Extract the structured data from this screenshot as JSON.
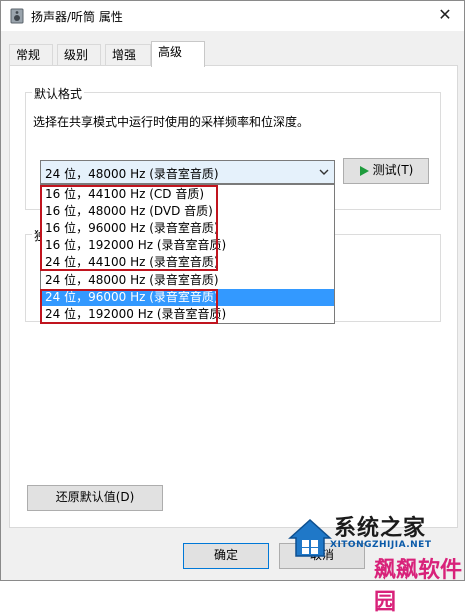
{
  "window": {
    "title": "扬声器/听筒 属性",
    "close_glyph": "✕"
  },
  "tabs": [
    {
      "label": "常规"
    },
    {
      "label": "级别"
    },
    {
      "label": "增强"
    },
    {
      "label": "高级",
      "active": true
    }
  ],
  "default_format": {
    "group_label": "默认格式",
    "description": "选择在共享模式中运行时使用的采样频率和位深度。",
    "selected": "24 位，48000 Hz (录音室音质)",
    "test_button": "测试(T)",
    "options": [
      "16 位，44100 Hz (CD 音质)",
      "16 位，48000 Hz (DVD 音质)",
      "16 位，96000 Hz (录音室音质)",
      "16 位，192000 Hz (录音室音质)",
      "24 位，44100 Hz (录音室音质)",
      "24 位，48000 Hz (录音室音质)",
      "24 位，96000 Hz (录音室音质)",
      "24 位，192000 Hz (录音室音质)"
    ],
    "highlighted_option_index": 6
  },
  "exclusive_group": {
    "label_partial": "独"
  },
  "buttons": {
    "restore_defaults": "还原默认值(D)",
    "ok": "确定",
    "cancel": "取消"
  },
  "watermark": {
    "top_text": "系统之家",
    "url": "XITONGZHIJIA.NET",
    "bottom_text": "飙飙软件园"
  },
  "colors": {
    "selection": "#3399ff",
    "annotation_red": "#c0141e",
    "combo_focus": "#e5f1fb",
    "play_green": "#1e9b3c"
  }
}
